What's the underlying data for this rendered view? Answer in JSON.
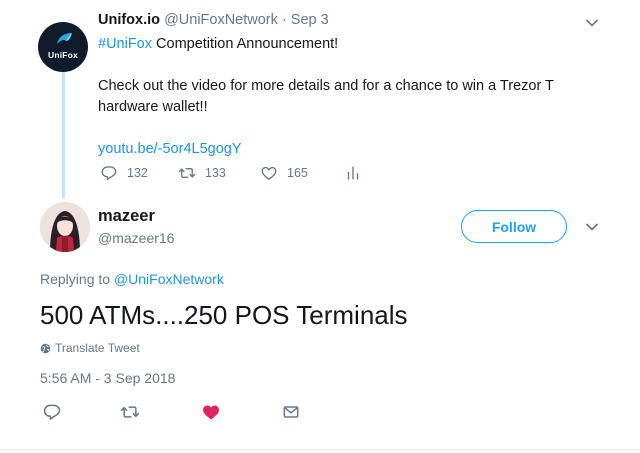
{
  "parent_tweet": {
    "avatar_text": "UniFox",
    "name": "Unifox.io",
    "handle": "@UniFoxNetwork",
    "separator": "·",
    "date": "Sep 3",
    "hashtag": "#UniFox",
    "line1_rest": " Competition Announcement!",
    "line2": "Check out the video for more details and for a chance to win a Trezor T hardware wallet!!",
    "link": "youtu.be/-5or4L5gogY",
    "reply_count": "132",
    "retweet_count": "133",
    "like_count": "165"
  },
  "focus_tweet": {
    "name": "mazeer",
    "handle": "@mazeer16",
    "follow_label": "Follow",
    "replying_prefix": "Replying to",
    "replying_mention": "@UniFoxNetwork",
    "text": "500 ATMs....250 POS Terminals",
    "translate_label": "Translate Tweet",
    "timestamp": "5:56 AM - 3 Sep 2018"
  },
  "colors": {
    "accent": "#1da1f2",
    "link": "#1b95e0",
    "muted": "#657786",
    "like": "#e0245e",
    "thread_line": "#c4e1f5"
  },
  "icons": {
    "reply": "reply-icon",
    "retweet": "retweet-icon",
    "like": "heart-icon",
    "like_active": "heart-filled-icon",
    "analytics": "analytics-icon",
    "message": "envelope-icon",
    "caret": "chevron-down-icon",
    "globe": "globe-icon"
  }
}
